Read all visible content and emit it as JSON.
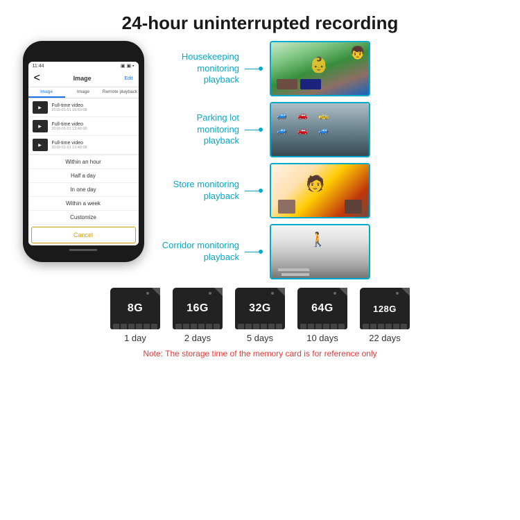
{
  "header": {
    "title": "24-hour uninterrupted recording"
  },
  "phone": {
    "time": "11:44",
    "nav_back": "<",
    "nav_title": "Image",
    "nav_edit": "Edit",
    "tabs": [
      "Image",
      "Image",
      "Remote playback"
    ],
    "videos": [
      {
        "label": "Full-time video",
        "date": "2019-01-01 15:50:08"
      },
      {
        "label": "Full-time video",
        "date": "2019-01-01 13:45:00"
      },
      {
        "label": "Full-time video",
        "date": "2019-01-01 13:40:08"
      }
    ],
    "dropdown_items": [
      "Within an hour",
      "Half a day",
      "In one day",
      "Within a week",
      "Customize"
    ],
    "cancel_label": "Cancel"
  },
  "monitoring": {
    "items": [
      {
        "label": "Housekeeping\nmonitoring playback",
        "img_class": "img-housekeeping"
      },
      {
        "label": "Parking lot\nmonitoring playback",
        "img_class": "img-parking"
      },
      {
        "label": "Store monitoring\nplayback",
        "img_class": "img-store"
      },
      {
        "label": "Corridor monitoring\nplayback",
        "img_class": "img-corridor"
      }
    ]
  },
  "storage": {
    "cards": [
      {
        "label": "8G",
        "days": "1 day"
      },
      {
        "label": "16G",
        "days": "2 days"
      },
      {
        "label": "32G",
        "days": "5 days"
      },
      {
        "label": "64G",
        "days": "10 days"
      },
      {
        "label": "128G",
        "days": "22 days"
      }
    ],
    "note": "Note: The storage time of the memory card is for reference only"
  }
}
